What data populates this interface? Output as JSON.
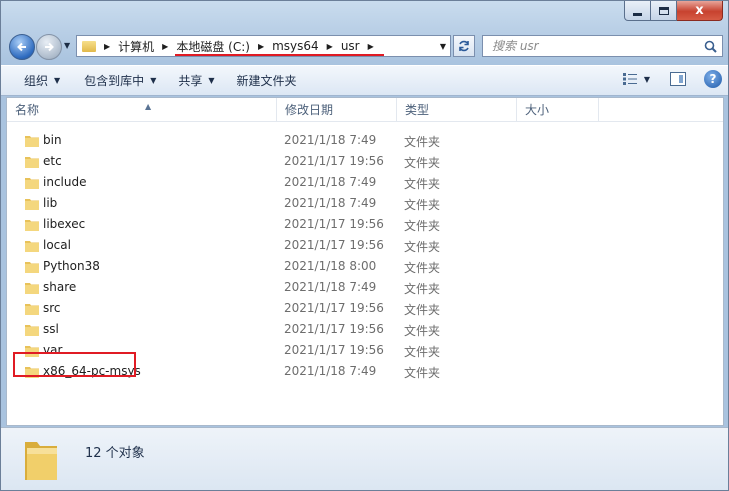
{
  "window": {
    "caption_buttons": {
      "close": "x"
    }
  },
  "address": {
    "breadcrumbs": [
      "计算机",
      "本地磁盘 (C:)",
      "msys64",
      "usr"
    ]
  },
  "search": {
    "placeholder": "搜索 usr"
  },
  "toolbar": {
    "organize": "组织",
    "include_in_library": "包含到库中",
    "share": "共享",
    "new_folder": "新建文件夹"
  },
  "columns": {
    "name": "名称",
    "date_modified": "修改日期",
    "type": "类型",
    "size": "大小"
  },
  "files": [
    {
      "name": "bin",
      "date": "2021/1/18 7:49",
      "type": "文件夹"
    },
    {
      "name": "etc",
      "date": "2021/1/17 19:56",
      "type": "文件夹"
    },
    {
      "name": "include",
      "date": "2021/1/18 7:49",
      "type": "文件夹"
    },
    {
      "name": "lib",
      "date": "2021/1/18 7:49",
      "type": "文件夹"
    },
    {
      "name": "libexec",
      "date": "2021/1/17 19:56",
      "type": "文件夹"
    },
    {
      "name": "local",
      "date": "2021/1/17 19:56",
      "type": "文件夹"
    },
    {
      "name": "Python38",
      "date": "2021/1/18 8:00",
      "type": "文件夹"
    },
    {
      "name": "share",
      "date": "2021/1/18 7:49",
      "type": "文件夹"
    },
    {
      "name": "src",
      "date": "2021/1/17 19:56",
      "type": "文件夹"
    },
    {
      "name": "ssl",
      "date": "2021/1/17 19:56",
      "type": "文件夹"
    },
    {
      "name": "var",
      "date": "2021/1/17 19:56",
      "type": "文件夹"
    },
    {
      "name": "x86_64-pc-msys",
      "date": "2021/1/18 7:49",
      "type": "文件夹"
    }
  ],
  "status": {
    "item_count": "12 个对象"
  },
  "colors": {
    "annotation_red": "#e01b24",
    "folder_yellow": "#e8c25a"
  },
  "icons": [
    "back-arrow-icon",
    "forward-arrow-icon",
    "folder-icon",
    "refresh-icon",
    "search-icon",
    "view-options-icon",
    "preview-pane-icon",
    "help-icon"
  ]
}
